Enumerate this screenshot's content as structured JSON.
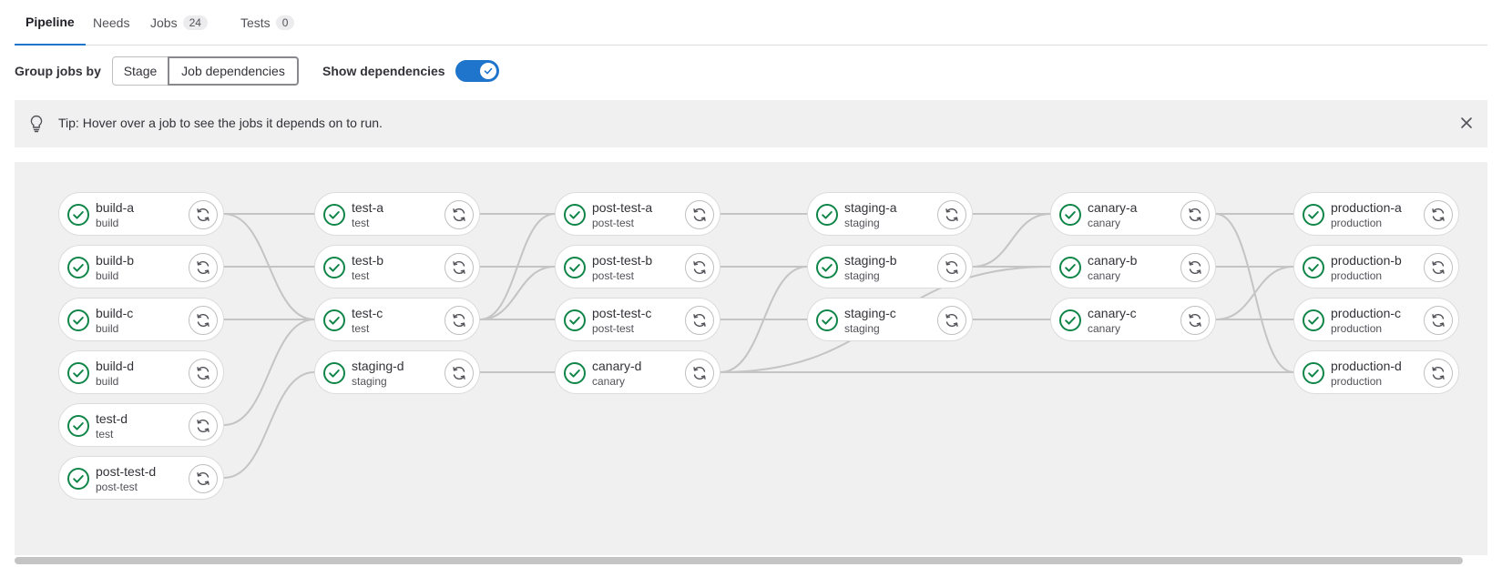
{
  "tabs": [
    {
      "label": "Pipeline",
      "count": ""
    },
    {
      "label": "Needs",
      "count": ""
    },
    {
      "label": "Jobs",
      "count": "24"
    },
    {
      "label": "Tests",
      "count": "0"
    }
  ],
  "controls": {
    "group_label": "Group jobs by",
    "stage_label": "Stage",
    "job_deps_label": "Job dependencies",
    "show_deps_label": "Show dependencies",
    "show_deps_on": true
  },
  "tip": {
    "text": "Tip: Hover over a job to see the jobs it depends on to run."
  },
  "colors": {
    "success": "#108548",
    "accent": "#1f75cb",
    "link": "#c4c4c4"
  },
  "columns": [
    [
      {
        "name": "build-a",
        "stage": "build"
      },
      {
        "name": "build-b",
        "stage": "build"
      },
      {
        "name": "build-c",
        "stage": "build"
      },
      {
        "name": "build-d",
        "stage": "build"
      },
      {
        "name": "test-d",
        "stage": "test"
      },
      {
        "name": "post-test-d",
        "stage": "post-test"
      }
    ],
    [
      {
        "name": "test-a",
        "stage": "test"
      },
      {
        "name": "test-b",
        "stage": "test"
      },
      {
        "name": "test-c",
        "stage": "test"
      },
      {
        "name": "staging-d",
        "stage": "staging"
      }
    ],
    [
      {
        "name": "post-test-a",
        "stage": "post-test"
      },
      {
        "name": "post-test-b",
        "stage": "post-test"
      },
      {
        "name": "post-test-c",
        "stage": "post-test"
      },
      {
        "name": "canary-d",
        "stage": "canary"
      }
    ],
    [
      {
        "name": "staging-a",
        "stage": "staging"
      },
      {
        "name": "staging-b",
        "stage": "staging"
      },
      {
        "name": "staging-c",
        "stage": "staging"
      }
    ],
    [
      {
        "name": "canary-a",
        "stage": "canary"
      },
      {
        "name": "canary-b",
        "stage": "canary"
      },
      {
        "name": "canary-c",
        "stage": "canary"
      }
    ],
    [
      {
        "name": "production-a",
        "stage": "production"
      },
      {
        "name": "production-b",
        "stage": "production"
      },
      {
        "name": "production-c",
        "stage": "production"
      },
      {
        "name": "production-d",
        "stage": "production"
      }
    ]
  ],
  "links": [
    [
      "build-a",
      "test-a"
    ],
    [
      "build-a",
      "test-c"
    ],
    [
      "build-b",
      "test-b"
    ],
    [
      "build-c",
      "test-c"
    ],
    [
      "test-d",
      "test-c"
    ],
    [
      "post-test-d",
      "staging-d"
    ],
    [
      "test-a",
      "post-test-a"
    ],
    [
      "test-b",
      "post-test-b"
    ],
    [
      "test-c",
      "post-test-a"
    ],
    [
      "test-c",
      "post-test-b"
    ],
    [
      "test-c",
      "post-test-c"
    ],
    [
      "staging-d",
      "canary-d"
    ],
    [
      "post-test-a",
      "staging-a"
    ],
    [
      "post-test-b",
      "staging-b"
    ],
    [
      "post-test-c",
      "staging-c"
    ],
    [
      "canary-d",
      "staging-b"
    ],
    [
      "canary-d",
      "production-d"
    ],
    [
      "canary-d",
      "canary-b"
    ],
    [
      "staging-a",
      "canary-a"
    ],
    [
      "staging-b",
      "canary-a"
    ],
    [
      "staging-b",
      "canary-b"
    ],
    [
      "staging-c",
      "canary-c"
    ],
    [
      "canary-a",
      "production-a"
    ],
    [
      "canary-a",
      "production-d"
    ],
    [
      "canary-b",
      "production-b"
    ],
    [
      "canary-c",
      "production-b"
    ],
    [
      "canary-c",
      "production-c"
    ]
  ]
}
